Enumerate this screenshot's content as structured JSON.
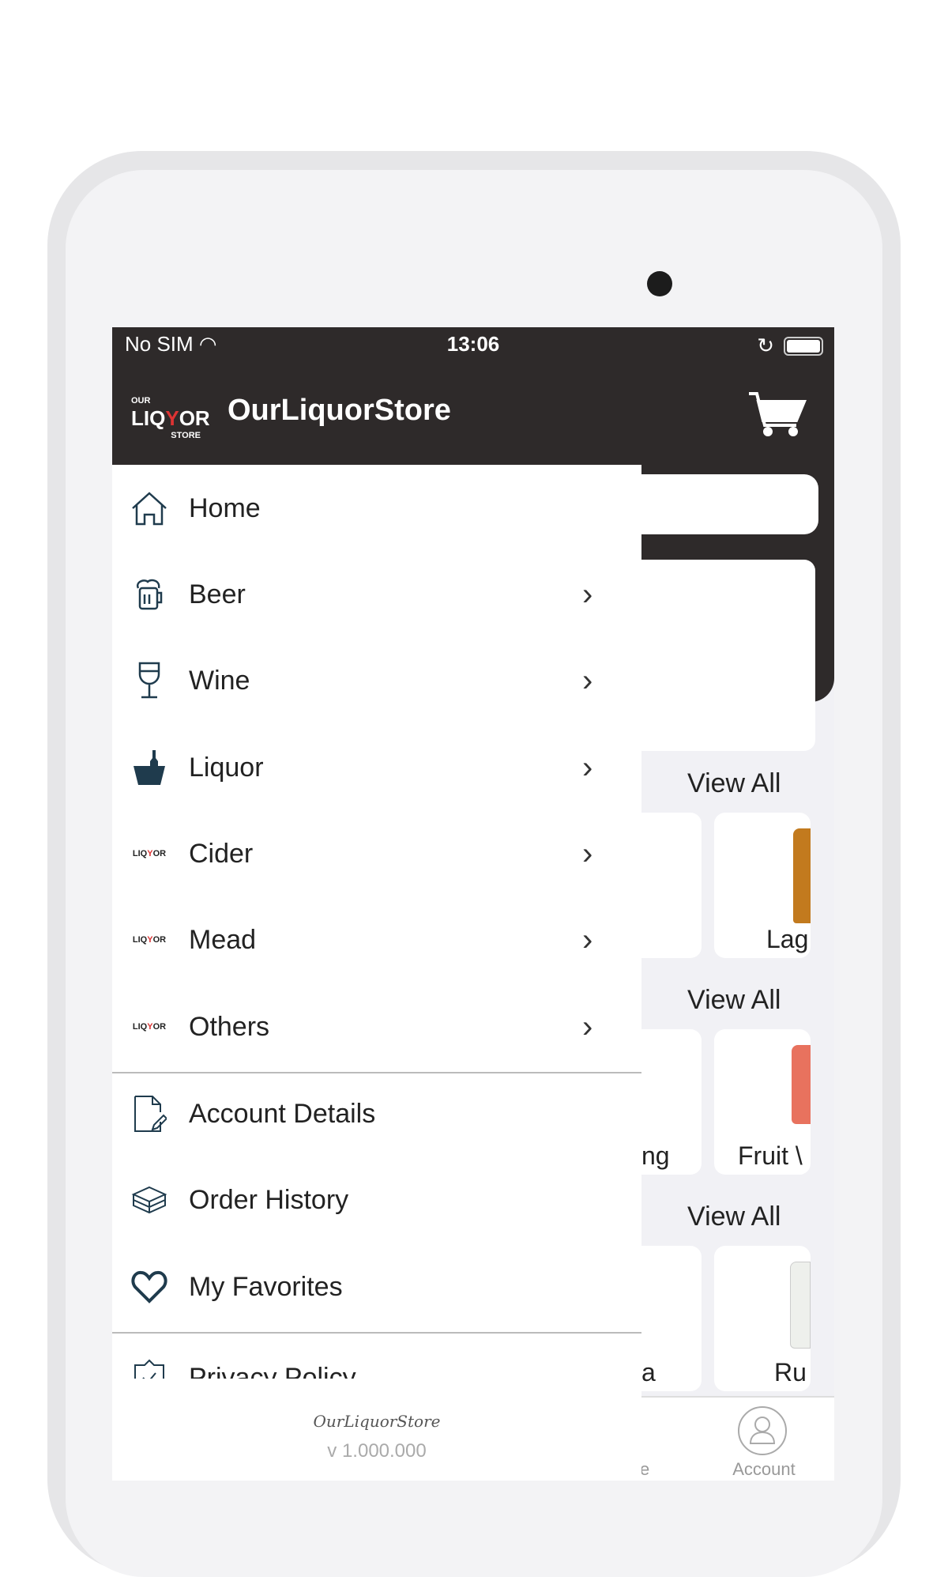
{
  "status_bar": {
    "carrier": "No SIM",
    "time": "13:06"
  },
  "header": {
    "logo_text": "OUR LIQUOR STORE",
    "title": "OurLiquorStore",
    "cart_icon": "cart-icon"
  },
  "background": {
    "view_all": [
      "View All",
      "View All",
      "View All"
    ],
    "product_labels": [
      "Lag",
      "Fruit \\",
      "Ru"
    ],
    "partial_labels": [
      "ng",
      "a"
    ],
    "bottom_nav": {
      "account_label": "Account",
      "partial_label": "e"
    }
  },
  "drawer": {
    "items": [
      {
        "label": "Home",
        "icon": "home-icon",
        "chevron": false
      },
      {
        "label": "Beer",
        "icon": "beer-mug-icon",
        "chevron": true
      },
      {
        "label": "Wine",
        "icon": "wine-glass-icon",
        "chevron": true
      },
      {
        "label": "Liquor",
        "icon": "ice-bucket-icon",
        "chevron": true
      },
      {
        "label": "Cider",
        "icon": "store-logo-icon",
        "chevron": true
      },
      {
        "label": "Mead",
        "icon": "store-logo-icon",
        "chevron": true
      },
      {
        "label": "Others",
        "icon": "store-logo-icon",
        "chevron": true
      }
    ],
    "account_items": [
      {
        "label": "Account Details",
        "icon": "document-edit-icon"
      },
      {
        "label": "Order History",
        "icon": "box-icon"
      },
      {
        "label": "My Favorites",
        "icon": "heart-icon"
      }
    ],
    "privacy": {
      "label": "Privacy Policy",
      "icon": "shield-check-icon"
    },
    "footer_logo": "OurLiquorStore",
    "version": "v 1.000.000"
  }
}
